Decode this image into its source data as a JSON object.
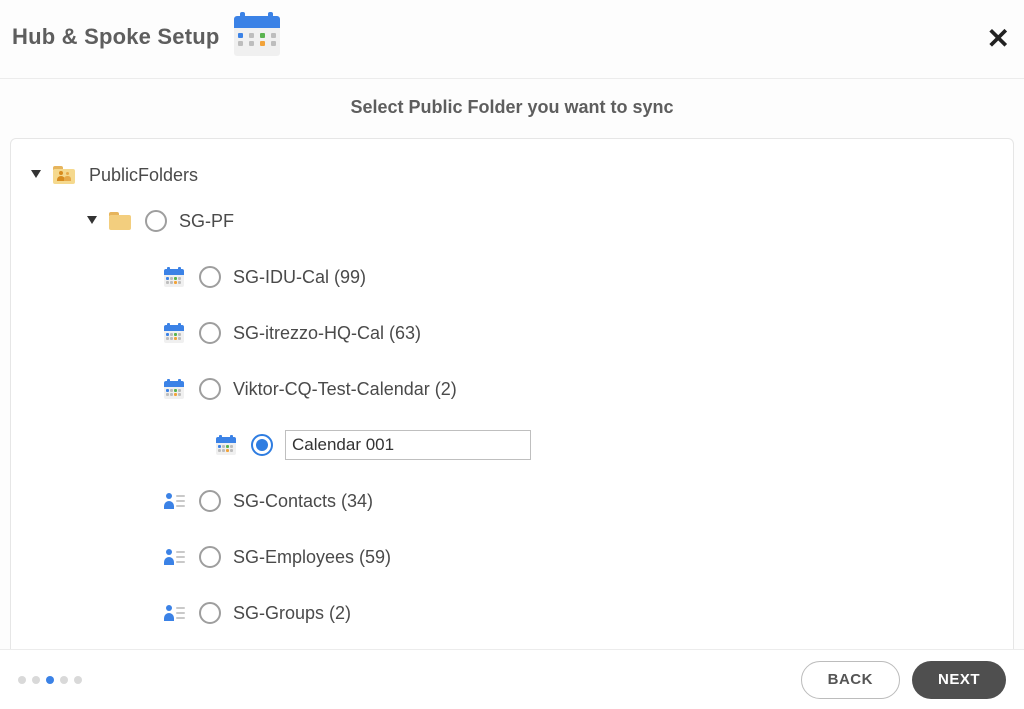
{
  "header": {
    "title": "Hub & Spoke Setup"
  },
  "instruction": "Select Public Folder you want to sync",
  "tree": {
    "root": {
      "label": "PublicFolders"
    },
    "sgpf": {
      "label": "SG-PF"
    },
    "items": [
      {
        "label": "SG-IDU-Cal (99)"
      },
      {
        "label": "SG-itrezzo-HQ-Cal (63)"
      },
      {
        "label": "Viktor-CQ-Test-Calendar (2)"
      },
      {
        "label": "SG-Contacts (34)"
      },
      {
        "label": "SG-Employees (59)"
      },
      {
        "label": "SG-Groups (2)"
      }
    ],
    "editable": {
      "value": "Calendar 001"
    }
  },
  "footer": {
    "back": "BACK",
    "next": "NEXT"
  },
  "steps": {
    "total": 5,
    "current_index": 2
  }
}
